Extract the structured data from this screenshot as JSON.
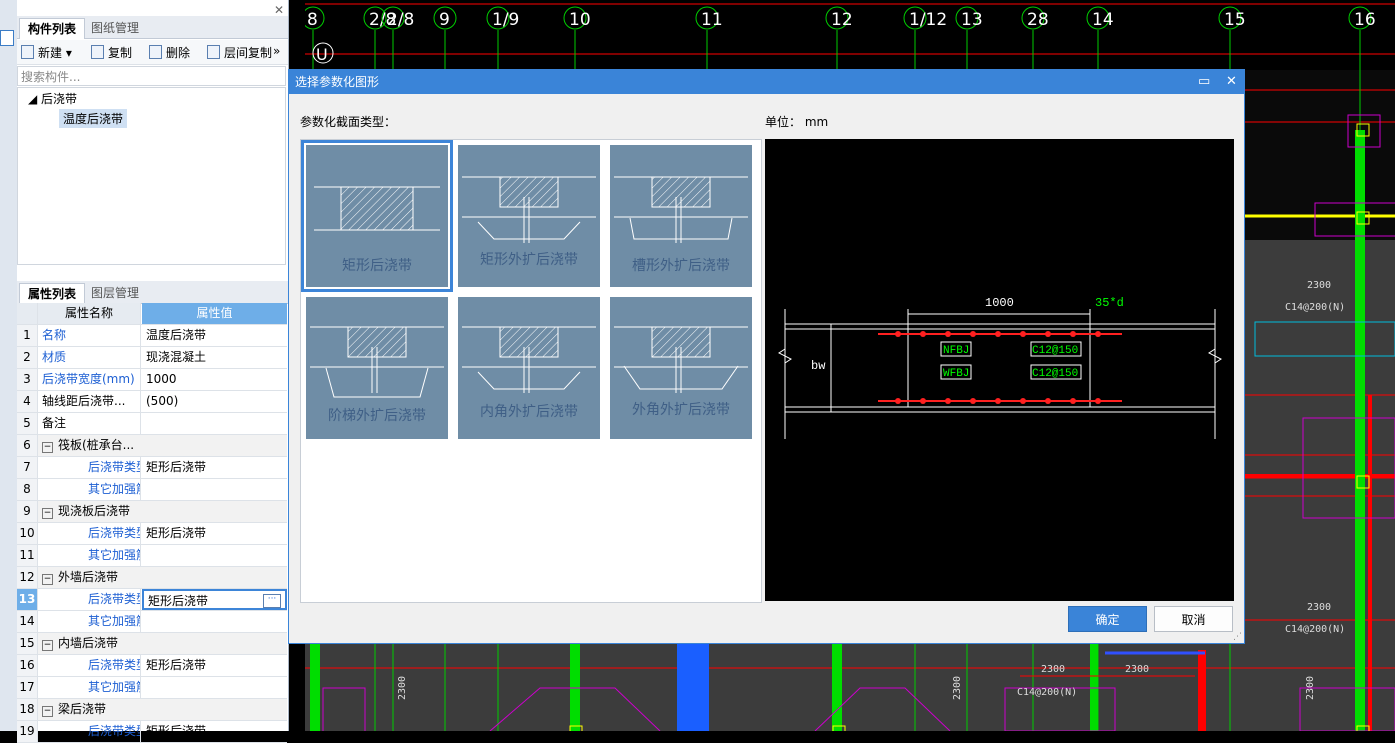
{
  "left_panel": {
    "tabs": [
      "构件列表",
      "图纸管理"
    ],
    "toolbar": {
      "new": "新建",
      "copy": "复制",
      "delete": "删除",
      "floor_copy": "层间复制"
    },
    "search_placeholder": "搜索构件...",
    "tree": {
      "parent": "后浇带",
      "child": "温度后浇带"
    },
    "prop_tabs": [
      "属性列表",
      "图层管理"
    ],
    "prop_header": {
      "name": "属性名称",
      "value": "属性值"
    },
    "rows": [
      {
        "n": "1",
        "name": "名称",
        "value": "温度后浇带",
        "blue": true
      },
      {
        "n": "2",
        "name": "材质",
        "value": "现浇混凝土",
        "blue": true
      },
      {
        "n": "3",
        "name": "后浇带宽度(mm)",
        "value": "1000",
        "blue": true
      },
      {
        "n": "4",
        "name": "轴线距后浇带...",
        "value": "(500)",
        "blue": false
      },
      {
        "n": "5",
        "name": "备注",
        "value": "",
        "blue": false
      },
      {
        "n": "6",
        "name": "筏板(桩承台...",
        "value": "",
        "group": true
      },
      {
        "n": "7",
        "name": "后浇带类型",
        "value": "矩形后浇带",
        "blue": true,
        "indent": true
      },
      {
        "n": "8",
        "name": "其它加强筋",
        "value": "",
        "blue": true,
        "indent": true
      },
      {
        "n": "9",
        "name": "现浇板后浇带",
        "value": "",
        "group": true
      },
      {
        "n": "10",
        "name": "后浇带类型",
        "value": "矩形后浇带",
        "blue": true,
        "indent": true
      },
      {
        "n": "11",
        "name": "其它加强筋",
        "value": "",
        "blue": true,
        "indent": true
      },
      {
        "n": "12",
        "name": "外墙后浇带",
        "value": "",
        "group": true
      },
      {
        "n": "13",
        "name": "后浇带类型",
        "value": "矩形后浇带",
        "blue": true,
        "indent": true,
        "selected": true
      },
      {
        "n": "14",
        "name": "其它加强筋",
        "value": "",
        "blue": true,
        "indent": true
      },
      {
        "n": "15",
        "name": "内墙后浇带",
        "value": "",
        "group": true
      },
      {
        "n": "16",
        "name": "后浇带类型",
        "value": "矩形后浇带",
        "blue": true,
        "indent": true
      },
      {
        "n": "17",
        "name": "其它加强筋",
        "value": "",
        "blue": true,
        "indent": true
      },
      {
        "n": "18",
        "name": "梁后浇带",
        "value": "",
        "group": true
      },
      {
        "n": "19",
        "name": "后浇带类型",
        "value": "矩形后浇带",
        "blue": true,
        "indent": true
      }
    ]
  },
  "cad": {
    "axis_labels": [
      "8",
      "2/8",
      "2/8",
      "9",
      "1/9",
      "10",
      "11",
      "12",
      "1/12",
      "13",
      "28",
      "14",
      "15",
      "16"
    ],
    "row_label": "U",
    "dims": [
      "2300",
      "C14@200(N)",
      "2300",
      "C14@200(N)",
      "2300",
      "2300",
      "C14@200(N)",
      "2300",
      "2300",
      "2300",
      "2300"
    ]
  },
  "dialog": {
    "title": "选择参数化图形",
    "section_label": "参数化截面类型：",
    "unit_label": "单位：  mm",
    "shapes": [
      "矩形后浇带",
      "矩形外扩后浇带",
      "槽形外扩后浇带",
      "阶梯外扩后浇带",
      "内角外扩后浇带",
      "外角外扩后浇带"
    ],
    "preview": {
      "width_dim": "1000",
      "lap": "35*d",
      "bw": "bw",
      "nfbj": "NFBJ",
      "wfbj": "WFBJ",
      "rebar1": "C12@150",
      "rebar2": "C12@150"
    },
    "ok": "确定",
    "cancel": "取消"
  },
  "colors": {
    "accent": "#3a84d8",
    "selected_header": "#6eaee8",
    "cad_green": "#00dd00",
    "cad_red": "#ff0000",
    "cad_magenta": "#cc00cc"
  }
}
